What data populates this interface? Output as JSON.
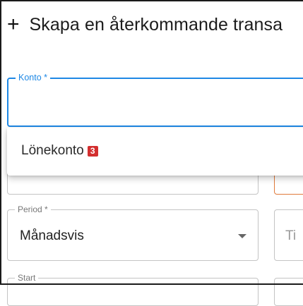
{
  "dialog": {
    "title": "Skapa en återkommande transa",
    "plus_icon": "plus-icon"
  },
  "konto": {
    "label": "Konto *",
    "value": "",
    "focus_color": "#1e88e5",
    "options": [
      {
        "label": "Lönekonto",
        "badge": "3",
        "badge_color": "#d32f2f"
      }
    ]
  },
  "period": {
    "label": "Period *",
    "value": "Månadsvis"
  },
  "titel": {
    "partial_text": "Ti"
  },
  "start": {
    "label": "Start"
  }
}
